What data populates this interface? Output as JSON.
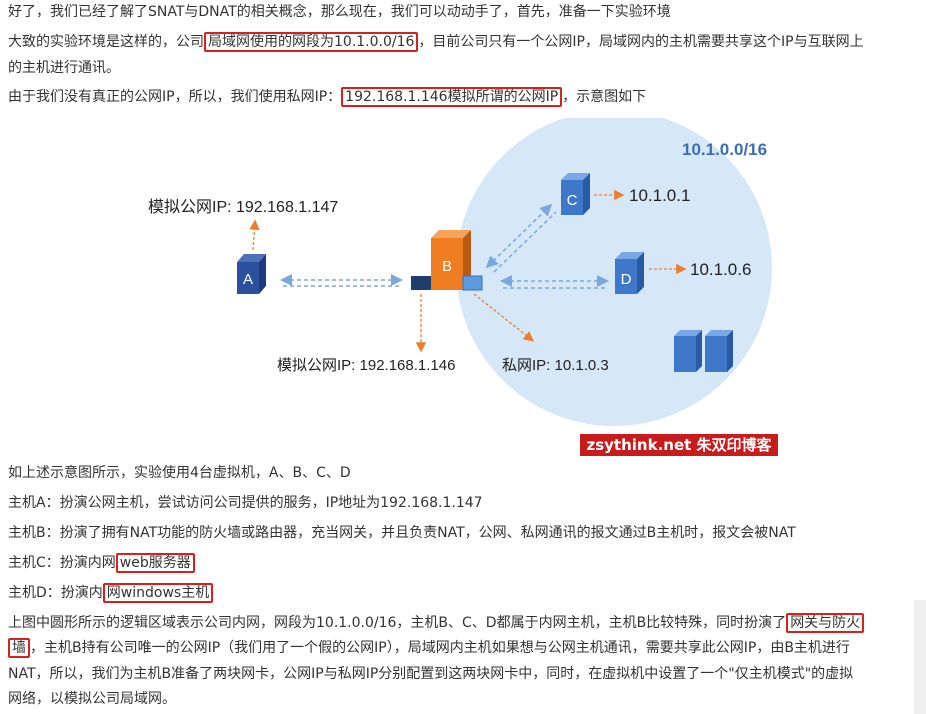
{
  "paragraphs": {
    "p1": "好了，我们已经了解了SNAT与DNAT的相关概念，那么现在，我们可以动动手了，首先，准备一下实验环境",
    "p2_a": "大致的实验环境是这样的，公司",
    "p2_hl": "局域网使用的网段为10.1.0.0/16",
    "p2_b": "，目前公司只有一个公网IP，局域网内的主机需要共享这个IP与互联网上",
    "p2_c": "的主机进行通讯。",
    "p3_a": "由于我们没有真正的公网IP，所以，我们使用私网IP：",
    "p3_hl": "192.168.1.146模拟所谓的公网IP",
    "p3_b": "，示意图如下",
    "p4": "如上述示意图所示，实验使用4台虚拟机，A、B、C、D",
    "p5": "主机A：扮演公网主机，尝试访问公司提供的服务，IP地址为192.168.1.147",
    "p6": "主机B：扮演了拥有NAT功能的防火墙或路由器，充当网关，并且负责NAT，公网、私网通讯的报文通过B主机时，报文会被NAT",
    "p7_a": "主机C：扮演内网",
    "p7_hl": "web服务器",
    "p8_a": "主机D：扮演内",
    "p8_hl": "网windows主机",
    "p9_a": "上图中圆形所示的逻辑区域表示公司内网，网段为10.1.0.0/16，主机B、C、D都属于内网主机，主机B比较特殊，同时扮演了",
    "p9_hl1": "网关与防火",
    "p10_hl2": "墙",
    "p10_b": "，主机B持有公司唯一的公网IP（我们用了一个假的公网IP），局域网内主机如果想与公网主机通讯，需要共享此公网IP，由B主机进行",
    "p11": "NAT，所以，我们为主机B准备了两块网卡，公网IP与私网IP分别配置到这两块网卡中，同时，在虚拟机中设置了一个\"仅主机模式\"的虚拟",
    "p12": "网络，以模拟公司局域网。"
  },
  "diagram": {
    "network_label": "10.1.0.0/16",
    "host_a": "A",
    "host_b": "B",
    "host_c": "C",
    "host_d": "D",
    "label_a_ip": "模拟公网IP: 192.168.1.147",
    "label_b_pub": "模拟公网IP: 192.168.1.146",
    "label_b_priv": "私网IP: 10.1.0.3",
    "label_c_ip": "10.1.0.1",
    "label_d_ip": "10.1.0.6"
  },
  "watermark": "zsythink.net 朱双印博客",
  "colors": {
    "highlight_border": "#d9201c",
    "circle_fill": "#d6e7f7",
    "host_blue": "#3f78c8",
    "host_a_blue": "#2c4f9e",
    "host_b_orange": "#ef7d22",
    "arrow_orange": "#ee7e2d",
    "arrow_blue": "#7aa7dc",
    "label_blue": "#3a6fb5"
  }
}
